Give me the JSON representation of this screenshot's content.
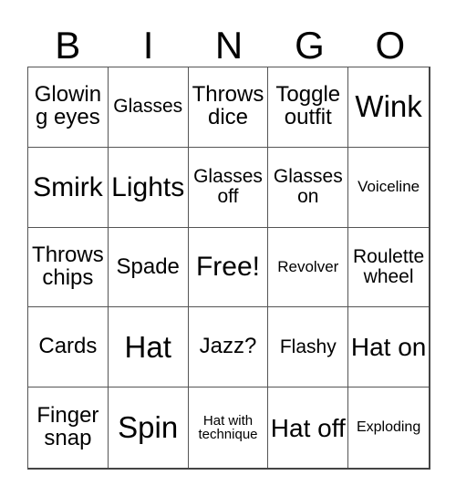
{
  "card": {
    "title_letters": [
      "B",
      "I",
      "N",
      "G",
      "O"
    ],
    "grid_columns": 5,
    "grid_rows": 5,
    "free_space_label": "Free!",
    "colors": {
      "background": "#ffffff",
      "text": "#000000",
      "grid_line": "#555555",
      "grid_outer": "#444444"
    },
    "cells": [
      {
        "text": "Glowing eyes",
        "size": "md"
      },
      {
        "text": "Glasses",
        "size": "sm"
      },
      {
        "text": "Throws dice",
        "size": "md"
      },
      {
        "text": "Toggle outfit",
        "size": "md"
      },
      {
        "text": "Wink",
        "size": "xxl"
      },
      {
        "text": "Smirk",
        "size": "xl"
      },
      {
        "text": "Lights",
        "size": "xl"
      },
      {
        "text": "Glasses off",
        "size": "sm"
      },
      {
        "text": "Glasses on",
        "size": "sm"
      },
      {
        "text": "Voiceline",
        "size": "xs"
      },
      {
        "text": "Throws chips",
        "size": "md"
      },
      {
        "text": "Spade",
        "size": "md"
      },
      {
        "text": "Free!",
        "size": "xl"
      },
      {
        "text": "Revolver",
        "size": "xs"
      },
      {
        "text": "Roulette wheel",
        "size": "sm"
      },
      {
        "text": "Cards",
        "size": "md"
      },
      {
        "text": "Hat",
        "size": "xxl"
      },
      {
        "text": "Jazz?",
        "size": "md"
      },
      {
        "text": "Flashy",
        "size": "sm"
      },
      {
        "text": "Hat on",
        "size": "lg"
      },
      {
        "text": "Finger snap",
        "size": "md"
      },
      {
        "text": "Spin",
        "size": "xxl"
      },
      {
        "text": "Hat with technique",
        "size": "tiny"
      },
      {
        "text": "Hat off",
        "size": "lg"
      },
      {
        "text": "Exploding",
        "size": "xxs"
      }
    ]
  }
}
